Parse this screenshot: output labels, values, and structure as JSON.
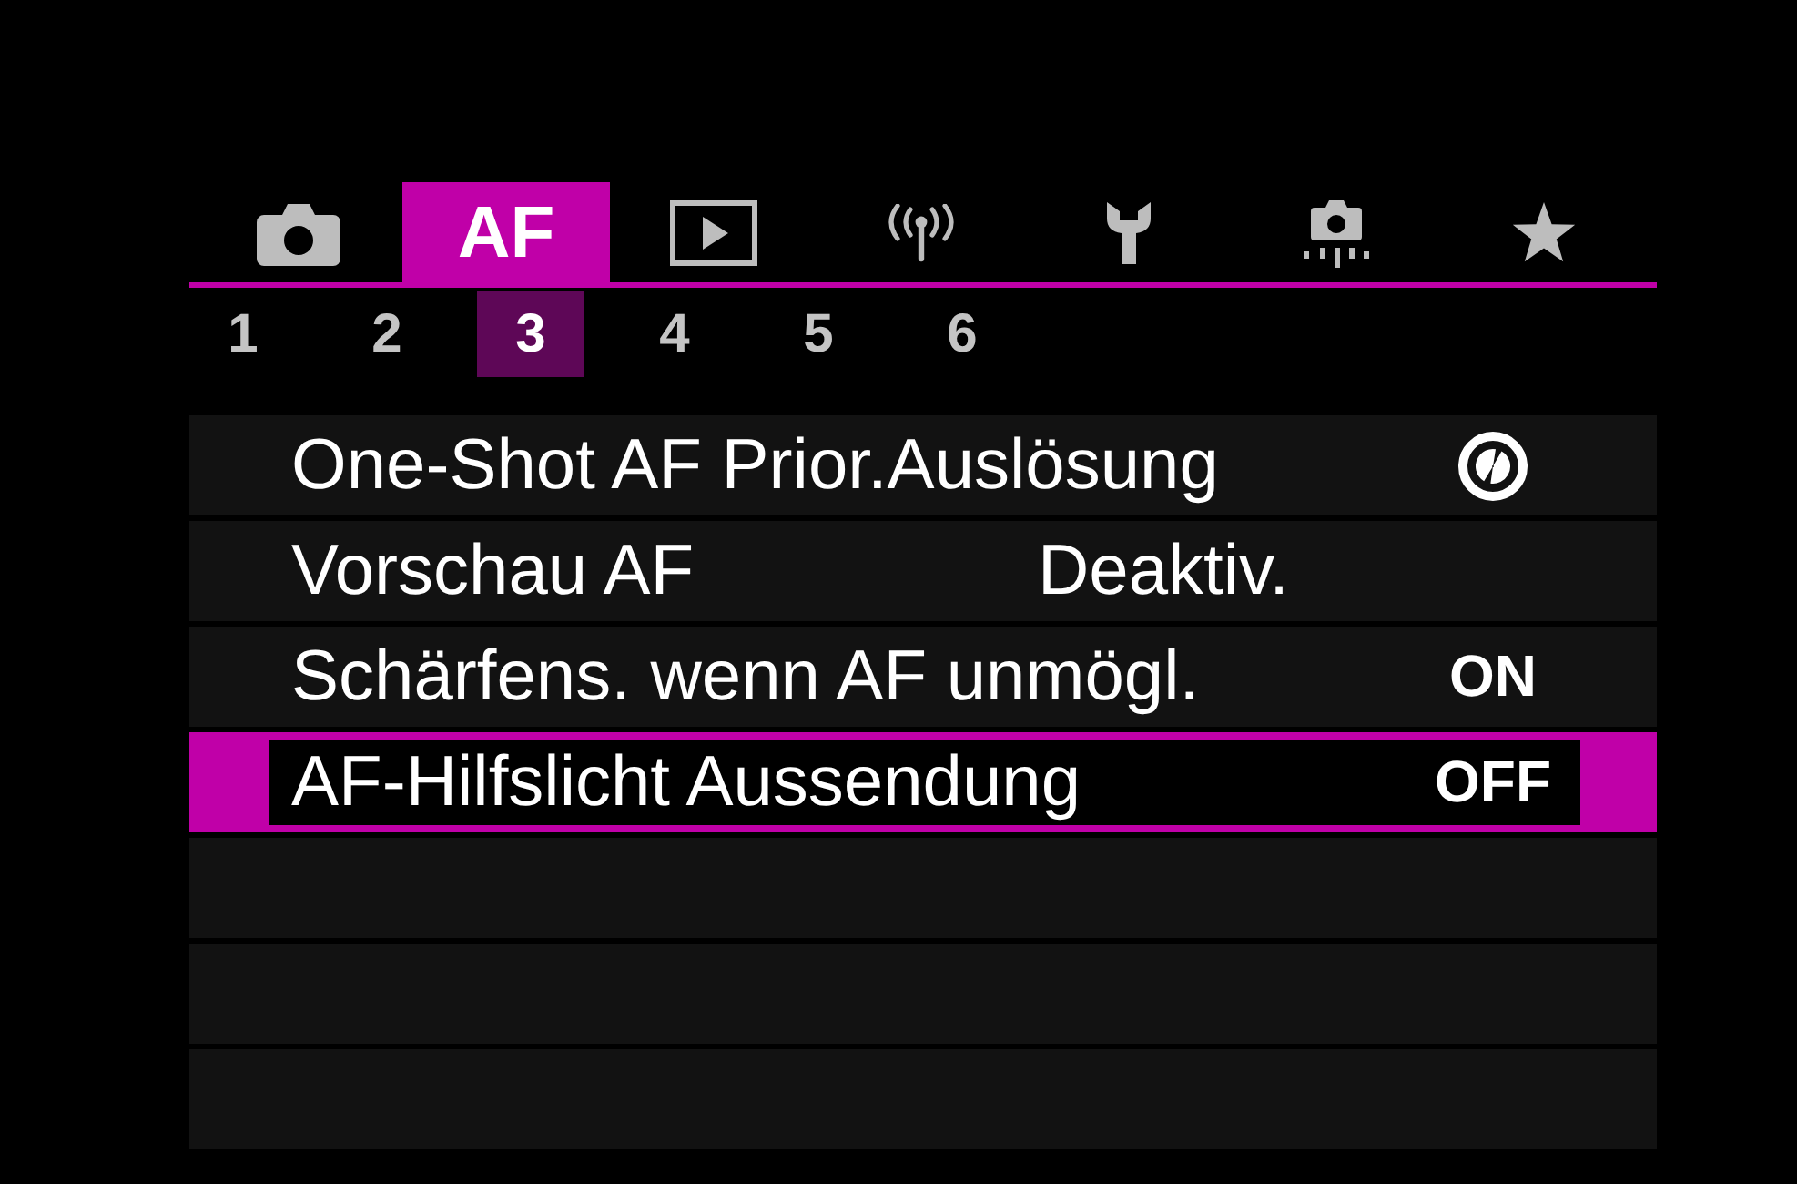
{
  "tabs": [
    {
      "kind": "shooting",
      "selected": false
    },
    {
      "kind": "text",
      "label": "AF",
      "selected": true
    },
    {
      "kind": "playback",
      "selected": false
    },
    {
      "kind": "wireless",
      "selected": false
    },
    {
      "kind": "setup",
      "selected": false
    },
    {
      "kind": "custom",
      "selected": false
    },
    {
      "kind": "mymenu",
      "selected": false
    }
  ],
  "pages": [
    {
      "label": "1",
      "selected": false
    },
    {
      "label": "2",
      "selected": false
    },
    {
      "label": "3",
      "selected": true
    },
    {
      "label": "4",
      "selected": false
    },
    {
      "label": "5",
      "selected": false
    },
    {
      "label": "6",
      "selected": false
    }
  ],
  "rows": [
    {
      "label": "One-Shot AF Prior.Auslösung",
      "kind": "icon",
      "selected": false
    },
    {
      "label": "Vorschau AF",
      "kind": "inline",
      "value": "Deaktiv.",
      "selected": false
    },
    {
      "label": "Schärfens. wenn AF unmögl.",
      "kind": "toggle",
      "value": "ON",
      "selected": false
    },
    {
      "label": "AF-Hilfslicht Aussendung",
      "kind": "toggle",
      "value": "OFF",
      "selected": true
    }
  ]
}
